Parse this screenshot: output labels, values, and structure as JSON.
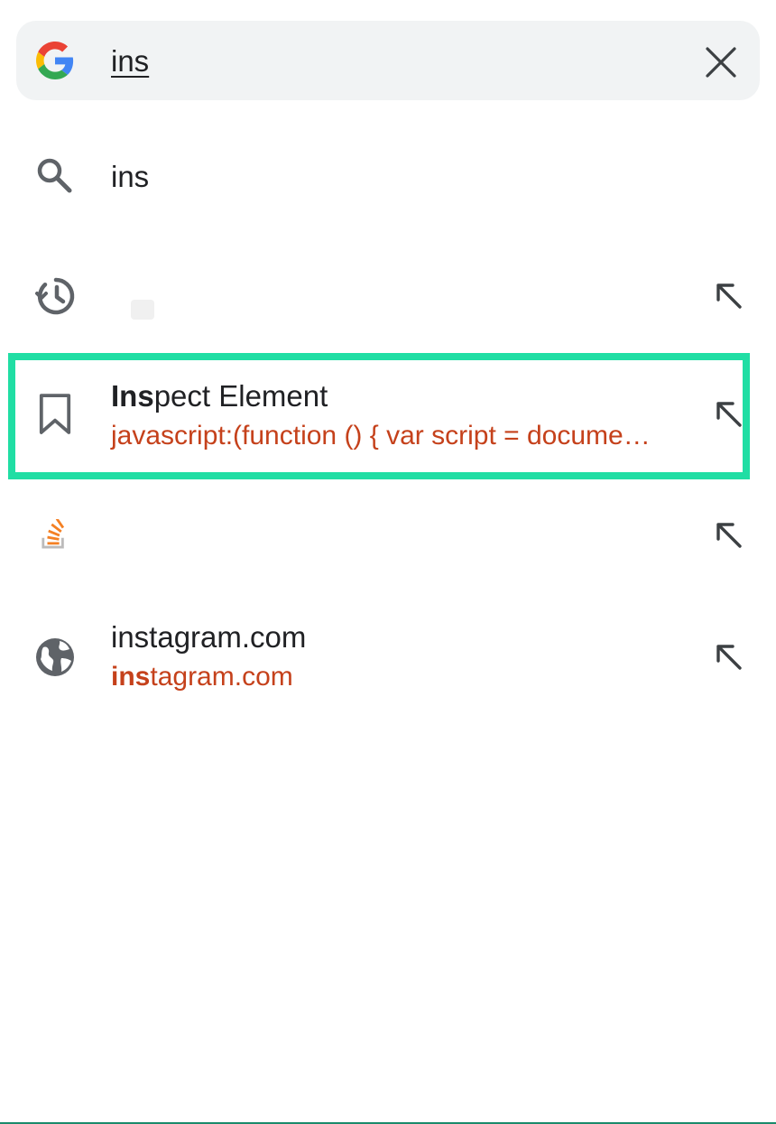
{
  "search": {
    "query": "ins",
    "engine_icon": "google-g-icon",
    "clear_icon": "close-icon"
  },
  "suggestions": [
    {
      "type": "search",
      "icon": "search-icon",
      "title": "ins"
    },
    {
      "type": "history",
      "icon": "history-icon",
      "title": "",
      "arrow_icon": "arrow-up-left-icon"
    },
    {
      "type": "bookmark",
      "icon": "bookmark-icon",
      "title_bold": "Ins",
      "title_rest": "pect Element",
      "subtitle": "javascript:(function () { var script = docume…",
      "arrow_icon": "arrow-up-left-icon"
    },
    {
      "type": "site",
      "icon": "stackoverflow-icon",
      "title": "",
      "arrow_icon": "arrow-up-left-icon"
    },
    {
      "type": "site",
      "icon": "globe-icon",
      "title": "instagram.com",
      "subtitle_bold": "ins",
      "subtitle_rest": "tagram.com",
      "arrow_icon": "arrow-up-left-icon"
    }
  ],
  "colors": {
    "accent_highlight": "#20dea4",
    "url_text": "#c5411b",
    "icon_gray": "#5f6368",
    "searchbar_bg": "#f1f3f4"
  }
}
